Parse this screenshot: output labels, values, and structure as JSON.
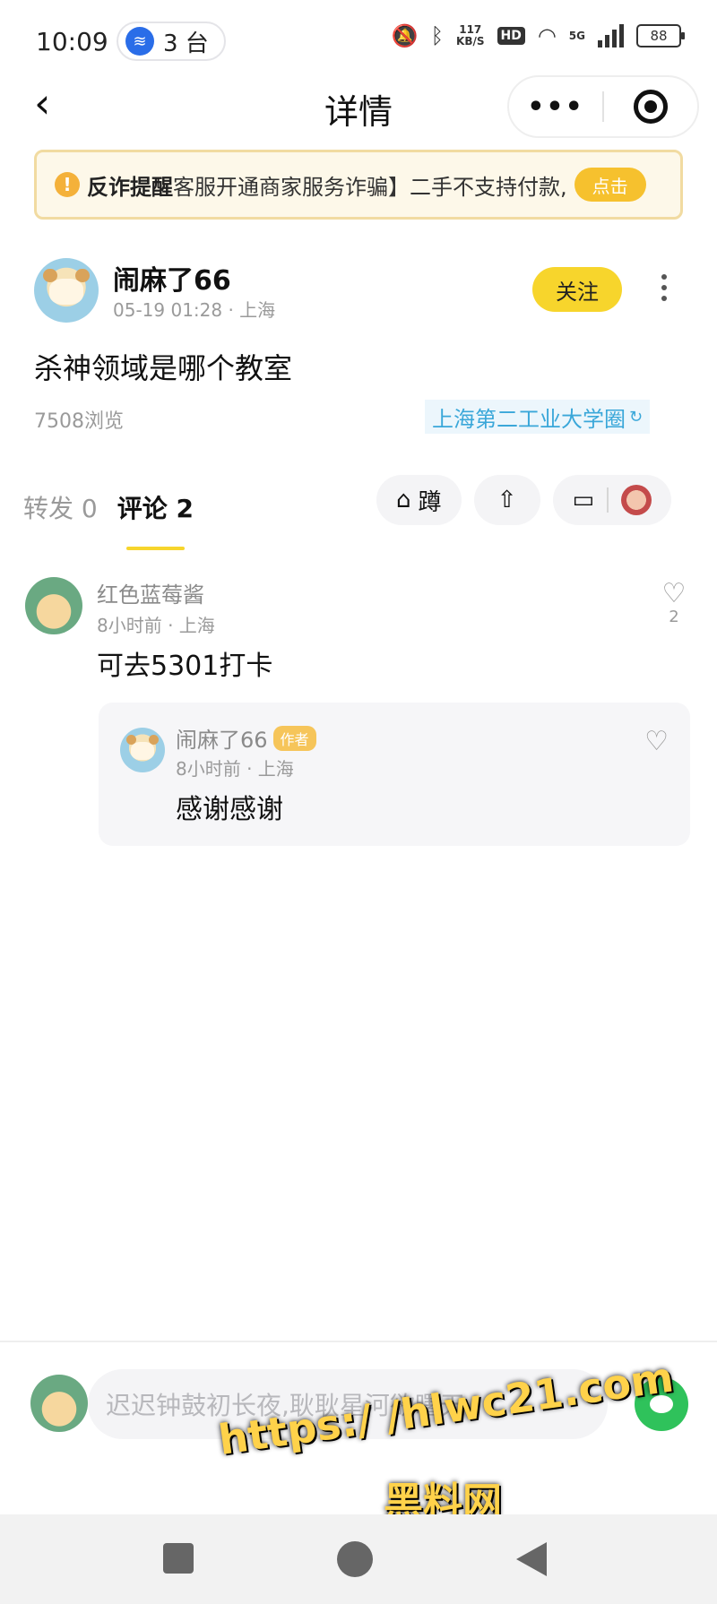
{
  "status_bar": {
    "time": "10:09",
    "hotspot_count": "3 台",
    "net_speed_value": "117",
    "net_speed_unit": "KB/S",
    "hd_badge": "HD",
    "network": "5G",
    "battery": "88"
  },
  "header": {
    "title": "详情"
  },
  "warning": {
    "title": "反诈提醒",
    "message": "客服开通商家服务诈骗】二手不支持付款,",
    "action": "点击",
    "accent_color": "#f6c12e"
  },
  "post": {
    "author": "闹麻了66",
    "meta": "05-19 01:28 · 上海",
    "follow_label": "关注",
    "title": "杀神领域是哪个教室",
    "views": "7508浏览",
    "circle": "上海第二工业大学圈"
  },
  "tabs": [
    {
      "label": "转发 0",
      "active": false
    },
    {
      "label": "评论 2",
      "active": true
    }
  ],
  "actions": {
    "squat_label": "蹲"
  },
  "comments": [
    {
      "name": "红色蓝莓酱",
      "meta": "8小时前 · 上海",
      "text": "可去5301打卡",
      "likes": "2",
      "reply": {
        "name": "闹麻了66",
        "badge": "作者",
        "meta": "8小时前 · 上海",
        "text": "感谢感谢"
      }
    }
  ],
  "composer": {
    "placeholder": "迟迟钟鼓初长夜,耿耿星河欲曙天。"
  },
  "watermark": {
    "url": "https:/ /hlwc21.com",
    "label": "黑料网"
  },
  "colors": {
    "brand_yellow": "#f7d52c",
    "circle_blue": "#3aa7d9",
    "wechat_green": "#2fc25b"
  }
}
